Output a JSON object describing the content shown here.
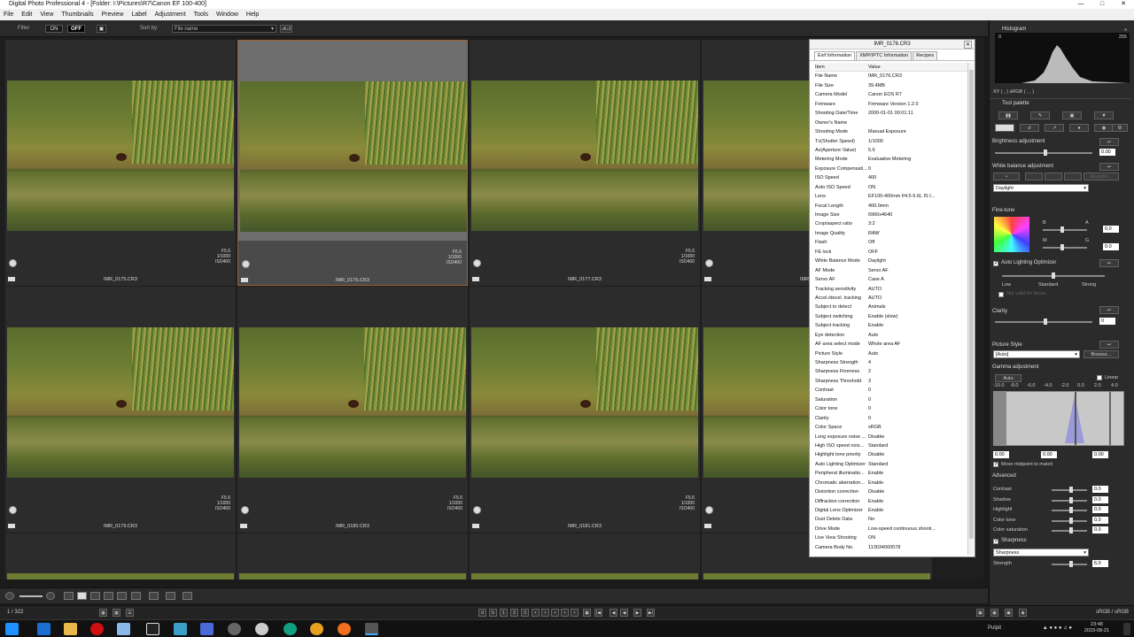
{
  "window": {
    "title": "Digital Photo Professional 4 - [Folder: I:\\Pictures\\R7\\Canon EF 100-400]"
  },
  "menu": [
    "File",
    "Edit",
    "View",
    "Thumbnails",
    "Preview",
    "Label",
    "Adjustment",
    "Tools",
    "Window",
    "Help"
  ],
  "filter": {
    "label": "Filter",
    "on": "ON",
    "off": "OFF",
    "sort_label": "Sort by:",
    "sort_value": "File name",
    "sort_dir": "↓A↓Z"
  },
  "thumbs": [
    {
      "name": "IMR_0175.CR3",
      "f": "F5.6",
      "t": "1/1000",
      "iso": "ISO400"
    },
    {
      "name": "IMR_0176.CR3",
      "f": "F5.6",
      "t": "1/1000",
      "iso": "ISO400"
    },
    {
      "name": "IMR_0177.CR3",
      "f": "F5.6",
      "t": "1/1000",
      "iso": "ISO400"
    },
    {
      "name": "IMR_0178.CR3",
      "f": "",
      "t": "",
      "iso": ""
    },
    {
      "name": "IMR_0179.CR3",
      "f": "F5.6",
      "t": "1/1000",
      "iso": "ISO400"
    },
    {
      "name": "IMR_0180.CR3",
      "f": "F5.6",
      "t": "1/1000",
      "iso": "ISO400"
    },
    {
      "name": "IMR_0181.CR3",
      "f": "F5.6",
      "t": "1/1000",
      "iso": "ISO400"
    },
    {
      "name": "",
      "f": "",
      "t": "",
      "iso": ""
    }
  ],
  "status": {
    "count": "1 / 322",
    "colorspace": "sRGB / sRGB"
  },
  "exif_panel": {
    "title": "IMR_0176.CR3",
    "tabs": [
      "Exif Information",
      "XMP/IPTC Information",
      "Recipes"
    ],
    "header": {
      "item": "Item",
      "value": "Value"
    },
    "rows": [
      [
        "File Name",
        "IMR_0176.CR3"
      ],
      [
        "File Size",
        "39.4MB"
      ],
      [
        "Camera Model",
        "Canon EOS R7"
      ],
      [
        "Firmware",
        "Firmware Version 1.2.0"
      ],
      [
        "Shooting Date/Time",
        "2000-01-01 00:01:11"
      ],
      [
        "Owner's Name",
        ""
      ],
      [
        "Shooting Mode",
        "Manual Exposure"
      ],
      [
        "Tv(Shutter Speed)",
        "1/1000"
      ],
      [
        "Av(Aperture Value)",
        "5.6"
      ],
      [
        "Metering Mode",
        "Evaluative Metering"
      ],
      [
        "Exposure Compensati...",
        "0"
      ],
      [
        "ISO Speed",
        "400"
      ],
      [
        "Auto ISO Speed",
        "ON"
      ],
      [
        "Lens",
        "EF100-400mm f/4.5-5.6L IS I..."
      ],
      [
        "Focal Length",
        "400.0mm"
      ],
      [
        "Image Size",
        "6960x4640"
      ],
      [
        "Crop/aspect ratio",
        "3:2"
      ],
      [
        "Image Quality",
        "RAW"
      ],
      [
        "Flash",
        "Off"
      ],
      [
        "FE lock",
        "OFF"
      ],
      [
        "White Balance Mode",
        "Daylight"
      ],
      [
        "AF Mode",
        "Servo AF"
      ],
      [
        "Servo AF",
        "Case A"
      ],
      [
        "Tracking sensitivity",
        "AUTO"
      ],
      [
        "Accel./decel. tracking",
        "AUTO"
      ],
      [
        "Subject to detect",
        "Animals"
      ],
      [
        "Subject switching",
        "Enable (slow)"
      ],
      [
        "Subject tracking",
        "Enable"
      ],
      [
        "Eye detection",
        "Auto"
      ],
      [
        "AF area select mode",
        "Whole area AF"
      ],
      [
        "Picture Style",
        "Auto"
      ],
      [
        "Sharpness Strength",
        "4"
      ],
      [
        "Sharpness Fineness",
        "2"
      ],
      [
        "Sharpness Threshold",
        "3"
      ],
      [
        "Contrast",
        "0"
      ],
      [
        "Saturation",
        "0"
      ],
      [
        "Color tone",
        "0"
      ],
      [
        "Clarity",
        "0"
      ],
      [
        "Color Space",
        "sRGB"
      ],
      [
        "Long exposure noise ...",
        "Disable"
      ],
      [
        "High ISO speed nois...",
        "Standard"
      ],
      [
        "Highlight tone priority",
        "Disable"
      ],
      [
        "Auto Lighting Optimizer",
        "Standard"
      ],
      [
        "Peripheral illuminatio...",
        "Enable"
      ],
      [
        "Chromatic aberration...",
        "Enable"
      ],
      [
        "Distortion correction",
        "Disable"
      ],
      [
        "Diffraction correction",
        "Enable"
      ],
      [
        "Digital Lens Optimizer",
        "Enable"
      ],
      [
        "Dust Delete Data",
        "No"
      ],
      [
        "Drive Mode",
        "Low-speed continuous shooti..."
      ],
      [
        "Live View Shooting",
        "ON"
      ],
      [
        "Camera Body No.",
        "113034000578"
      ]
    ]
  },
  "tools": {
    "histogram_label": "Histogram",
    "hist_min": "0",
    "hist_max": "255",
    "hist_readout": "XY (   ,   )     sRGB (   ,   ,   )",
    "tool_palette": "Tool palette",
    "brightness": {
      "label": "Brightness adjustment",
      "value": "0.00"
    },
    "wb": {
      "label": "White balance adjustment",
      "preset": "Daylight",
      "register": "Register..."
    },
    "finetune": {
      "label": "Fine-tune",
      "b": "B",
      "a": "A",
      "m": "M",
      "g": "G",
      "v1": "0.0",
      "v2": "0.0"
    },
    "alo": {
      "label": "Auto Lighting Optimizer",
      "low": "Low",
      "std": "Standard",
      "strong": "Strong",
      "noface": "Not valid for faces"
    },
    "clarity": {
      "label": "Clarity",
      "value": "0"
    },
    "picstyle": {
      "label": "Picture Style",
      "value": "[Auto]",
      "browse": "Browse..."
    },
    "gamma": {
      "label": "Gamma adjustment",
      "auto": "Auto",
      "linear": "Linear",
      "scale": [
        "-10.0",
        "-8.0",
        "-6.0",
        "-4.0",
        "-2.0",
        "0.0",
        "2.0",
        "4.0"
      ],
      "v_left": "0.00",
      "v_mid": "0.00",
      "v_right": "0.00",
      "midpoint": "Move midpoint to match"
    },
    "advanced": {
      "label": "Advanced",
      "items": [
        {
          "name": "Contrast",
          "value": "0.0"
        },
        {
          "name": "Shadow",
          "value": "0.0"
        },
        {
          "name": "Highlight",
          "value": "0.0"
        },
        {
          "name": "Color tone",
          "value": "0.0"
        },
        {
          "name": "Color saturation",
          "value": "0.0"
        }
      ]
    },
    "sharpness": {
      "label": "Sharpness",
      "mode": "Sharpness",
      "strength_label": "Strength",
      "strength": "6.0"
    }
  },
  "taskbar": {
    "pulpit": "Pulpit",
    "time": "23:48",
    "date": "2023-08-21"
  }
}
